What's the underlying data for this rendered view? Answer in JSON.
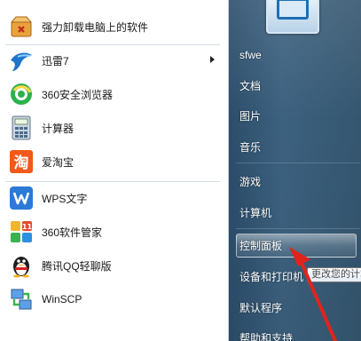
{
  "programs": [
    {
      "label": "强力卸载电脑上的软件",
      "icon": "uninstall-box-icon",
      "has_submenu": false
    },
    {
      "label": "迅雷7",
      "icon": "thunder-bird-icon",
      "has_submenu": true
    },
    {
      "label": "360安全浏览器",
      "icon": "360-browser-icon",
      "has_submenu": false
    },
    {
      "label": "计算器",
      "icon": "calculator-icon",
      "has_submenu": false
    },
    {
      "label": "爱淘宝",
      "icon": "taobao-icon",
      "has_submenu": false
    },
    {
      "label": "WPS文字",
      "icon": "wps-writer-icon",
      "has_submenu": false
    },
    {
      "label": "360软件管家",
      "icon": "360-software-manager-icon",
      "has_submenu": false
    },
    {
      "label": "腾讯QQ轻聊版",
      "icon": "qq-penguin-icon",
      "has_submenu": false
    },
    {
      "label": "WinSCP",
      "icon": "winscp-icon",
      "has_submenu": false
    }
  ],
  "right_menu": {
    "user": "sfwe",
    "documents": "文档",
    "pictures": "图片",
    "music": "音乐",
    "games": "游戏",
    "computer": "计算机",
    "control_panel": "控制面板",
    "devices_printers": "设备和打印机",
    "default_programs": "默认程序",
    "help_support": "帮助和支持"
  },
  "tooltip": "更改您的计算",
  "icon_glyphs": {
    "taobao": "淘",
    "software_badge": "11"
  },
  "colors": {
    "right_panel": "#35566f",
    "annotation_arrow": "#e0241c",
    "highlight_border": "#ffffff"
  }
}
